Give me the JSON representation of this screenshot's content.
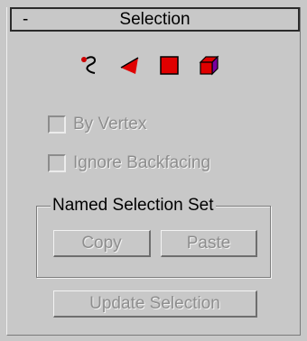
{
  "rollout": {
    "toggle": "-",
    "title": "Selection"
  },
  "subobject_icons": [
    {
      "name": "vertex-icon",
      "color": "#cc0000"
    },
    {
      "name": "edge-icon",
      "color": "#e00000"
    },
    {
      "name": "face-icon",
      "color": "#e00000"
    },
    {
      "name": "element-icon",
      "color": "#e00000"
    }
  ],
  "options": {
    "by_vertex": {
      "label": "By Vertex",
      "checked": false,
      "enabled": false
    },
    "ignore_backfacing": {
      "label": "Ignore Backfacing",
      "checked": false,
      "enabled": false
    }
  },
  "named_selection_set": {
    "title": "Named Selection Set",
    "copy_label": "Copy",
    "paste_label": "Paste"
  },
  "update_selection_label": "Update Selection"
}
